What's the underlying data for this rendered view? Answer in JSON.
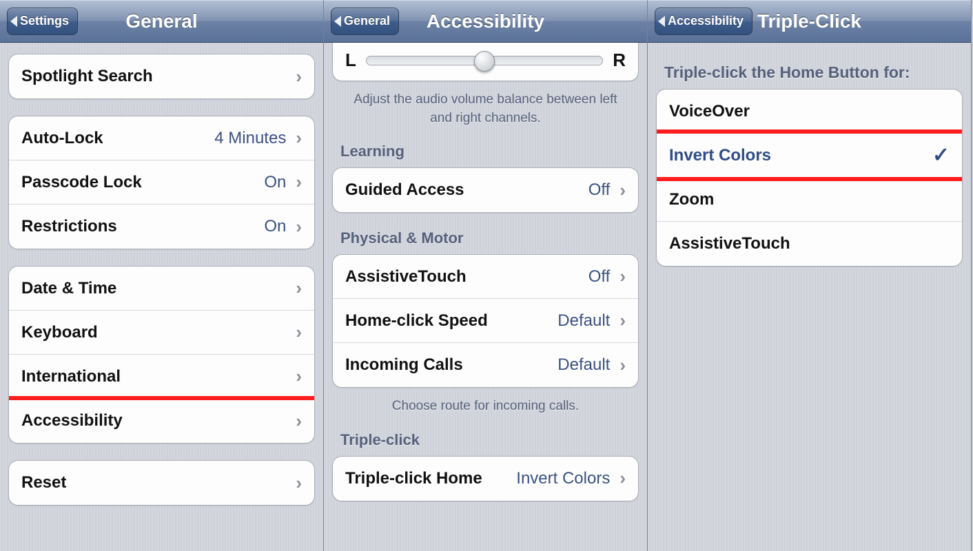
{
  "panel1": {
    "back": "Settings",
    "title": "General",
    "groups": [
      {
        "rows": [
          {
            "label": "Spotlight Search",
            "value": "",
            "chevron": true
          }
        ]
      },
      {
        "rows": [
          {
            "label": "Auto-Lock",
            "value": "4 Minutes",
            "chevron": true
          },
          {
            "label": "Passcode Lock",
            "value": "On",
            "chevron": true
          },
          {
            "label": "Restrictions",
            "value": "On",
            "chevron": true
          }
        ]
      },
      {
        "rows": [
          {
            "label": "Date & Time",
            "value": "",
            "chevron": true
          },
          {
            "label": "Keyboard",
            "value": "",
            "chevron": true
          },
          {
            "label": "International",
            "value": "",
            "chevron": true
          },
          {
            "label": "Accessibility",
            "value": "",
            "chevron": true,
            "highlight": true
          }
        ]
      },
      {
        "rows": [
          {
            "label": "Reset",
            "value": "",
            "chevron": true
          }
        ]
      }
    ]
  },
  "panel2": {
    "back": "General",
    "title": "Accessibility",
    "slider": {
      "left": "L",
      "right": "R"
    },
    "slider_note": "Adjust the audio volume balance between left and right channels.",
    "sections": [
      {
        "header": "Learning",
        "rows": [
          {
            "label": "Guided Access",
            "value": "Off",
            "chevron": true
          }
        ]
      },
      {
        "header": "Physical & Motor",
        "rows": [
          {
            "label": "AssistiveTouch",
            "value": "Off",
            "chevron": true
          },
          {
            "label": "Home-click Speed",
            "value": "Default",
            "chevron": true
          },
          {
            "label": "Incoming Calls",
            "value": "Default",
            "chevron": true
          }
        ],
        "footer": "Choose route for incoming calls."
      },
      {
        "header": "Triple-click",
        "rows": [
          {
            "label": "Triple-click Home",
            "value": "Invert Colors",
            "chevron": true,
            "highlight": true
          }
        ]
      }
    ]
  },
  "panel3": {
    "back": "Accessibility",
    "title": "Triple-Click",
    "header": "Triple-click the Home Button for:",
    "options": [
      {
        "label": "VoiceOver",
        "checked": false
      },
      {
        "label": "Invert Colors",
        "checked": true,
        "highlight": true
      },
      {
        "label": "Zoom",
        "checked": false
      },
      {
        "label": "AssistiveTouch",
        "checked": false
      }
    ]
  }
}
